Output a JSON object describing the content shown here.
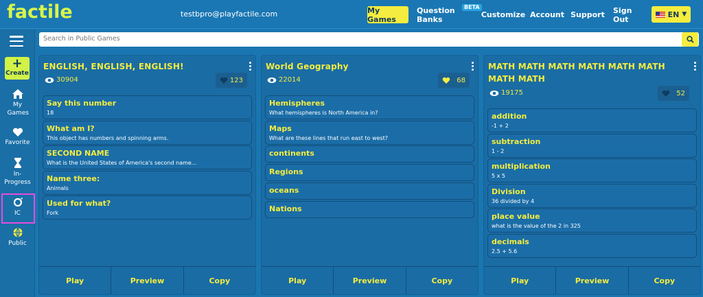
{
  "header": {
    "logo": "factile",
    "email": "testbpro@playfactile.com",
    "nav": [
      {
        "label": "My Games",
        "active": true
      },
      {
        "label": "Question Banks",
        "badge": "BETA"
      },
      {
        "label": "Customize"
      },
      {
        "label": "Account"
      },
      {
        "label": "Support"
      },
      {
        "label": "Sign Out"
      }
    ],
    "language": "EN"
  },
  "sidebar": {
    "create_label": "Create",
    "items": [
      {
        "label": "My Games",
        "icon": "home-icon"
      },
      {
        "label": "Favorite",
        "icon": "heart-icon"
      },
      {
        "label": "In-Progress",
        "icon": "hourglass-icon"
      },
      {
        "label": "IC",
        "icon": "ic-icon"
      },
      {
        "label": "Public",
        "icon": "globe-icon",
        "active": true
      }
    ]
  },
  "search": {
    "placeholder": "Search in Public Games"
  },
  "games": [
    {
      "title": "ENGLISH, ENGLISH, ENGLISH!",
      "views": "30904",
      "likes": "123",
      "questions": [
        {
          "title": "Say this number",
          "detail": "18"
        },
        {
          "title": "What am I?",
          "detail": "This object has numbers and spinning arms."
        },
        {
          "title": "SECOND NAME",
          "detail": "What is the United States of America's second name..."
        },
        {
          "title": "Name three:",
          "detail": "Animals"
        },
        {
          "title": "Used for what?",
          "detail": "Fork"
        }
      ]
    },
    {
      "title": "World Geography",
      "views": "22014",
      "likes": "68",
      "questions": [
        {
          "title": "Hemispheres",
          "detail": "What hemispheres is North America in?"
        },
        {
          "title": "Maps",
          "detail": "What are these lines that run east to west?"
        },
        {
          "title": "continents",
          "detail": ""
        },
        {
          "title": "Regions",
          "detail": ""
        },
        {
          "title": "oceans",
          "detail": ""
        },
        {
          "title": "Nations",
          "detail": ""
        }
      ]
    },
    {
      "title": "MATH MATH MATH MATH MATH MATH MATH MATH",
      "views": "19175",
      "likes": "52",
      "questions": [
        {
          "title": "addition",
          "detail": "-1 + 2"
        },
        {
          "title": "subtraction",
          "detail": "1 - 2"
        },
        {
          "title": "multiplication",
          "detail": "5 x 5"
        },
        {
          "title": "Division",
          "detail": "36 divided by 4"
        },
        {
          "title": "place value",
          "detail": "what is the value of the 2 in 325"
        },
        {
          "title": "decimals",
          "detail": "2.5 + 5.6"
        }
      ]
    }
  ],
  "actions": {
    "play": "Play",
    "preview": "Preview",
    "copy": "Copy"
  },
  "colors": {
    "accent": "#f4ec3f",
    "brand": "#d7f54a",
    "background": "#1a76b0",
    "highlight": "#e84be0"
  }
}
